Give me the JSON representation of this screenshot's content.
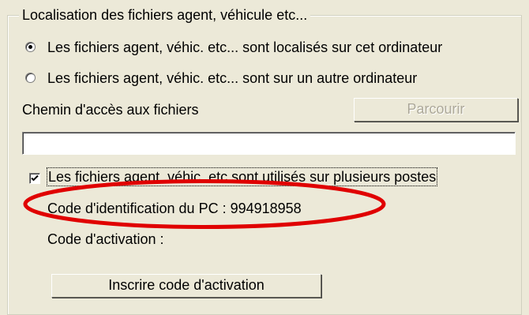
{
  "groupbox": {
    "title": "Localisation des fichiers agent, véhicule etc..."
  },
  "options": {
    "local_label": "Les fichiers agent, véhic. etc... sont localisés sur cet ordinateur",
    "remote_label": "Les fichiers agent, véhic. etc... sont sur un autre ordinateur",
    "selected": "local"
  },
  "path": {
    "label": "Chemin d'accès aux fichiers",
    "browse_label": "Parcourir",
    "value": ""
  },
  "multi_post": {
    "label": "Les fichiers agent, véhic. etc sont utilisés sur plusieurs postes",
    "checked": true
  },
  "identification": {
    "pc_code_text": "Code d'identification du PC : 994918958",
    "activation_code_label": "Code d'activation :",
    "register_button_label": "Inscrire code d'activation"
  },
  "colors": {
    "annotation": "#e00000",
    "window_bg": "#ece9d8",
    "disabled_text": "#aca899"
  },
  "icons": {
    "selected_radio": "radio-selected-icon",
    "checkbox_mark": "checkmark-icon"
  }
}
